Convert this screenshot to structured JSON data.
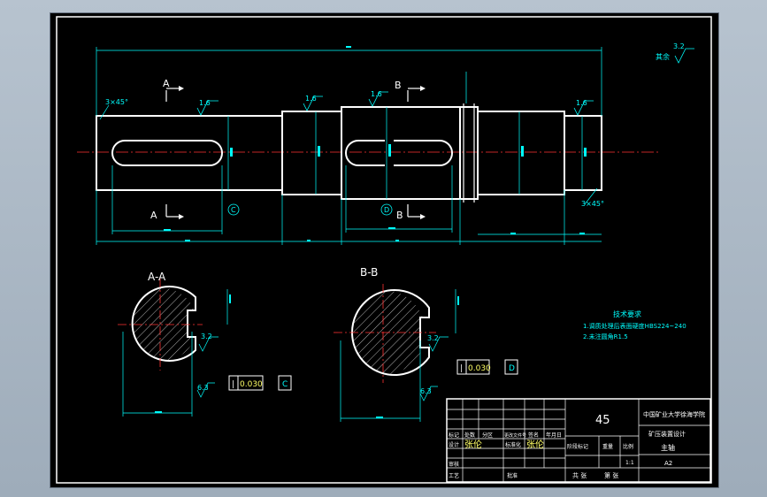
{
  "drawing": {
    "section_a_label": "A-A",
    "section_b_label": "B-B",
    "cut_a_top": "A",
    "cut_a_bottom": "A",
    "cut_b_top": "B",
    "cut_b_bottom": "B",
    "chamfer_left": "3×45°",
    "chamfer_right": "3×45°",
    "rough_general": "其余",
    "rough_general_value": "3.2",
    "rough_values": [
      "1.6",
      "1.6",
      "1.6",
      "1.6"
    ],
    "datum_c": "C",
    "datum_d": "D",
    "tol_a_symbol": "|",
    "tol_a_value": "0.030",
    "tol_a_datum": "C",
    "tol_b_symbol": "|",
    "tol_b_value": "0.030",
    "tol_b_datum": "D",
    "key_rough_a": "3.2",
    "key_rough_b": "3.2",
    "flank_rough_a": "6.3",
    "flank_rough_b": "6.3"
  },
  "tech_req": {
    "title": "技术要求",
    "line1": "1.调质处理后表面硬度HBS224~240",
    "line2": "2.未注圆角R1.5"
  },
  "title_block": {
    "material": "45",
    "school": "中国矿业大学徐海学院",
    "project": "矿压装置设计",
    "part_name": "主轴",
    "sheet_size": "A2",
    "scale": "1:1",
    "stage_label": "阶段标记",
    "weight_label": "重量",
    "ratio_label": "比例",
    "rev_headers": [
      "标记",
      "处数",
      "分区",
      "更改文件号",
      "签名",
      "年月日"
    ],
    "designer_label": "设计",
    "designer_name": "张伦",
    "std_label": "标准化",
    "std_name": "张伦",
    "check_label": "审核",
    "process_label": "工艺",
    "approve_label": "批准",
    "sheets_label": "共 张",
    "sheet_no_label": "第 张"
  }
}
